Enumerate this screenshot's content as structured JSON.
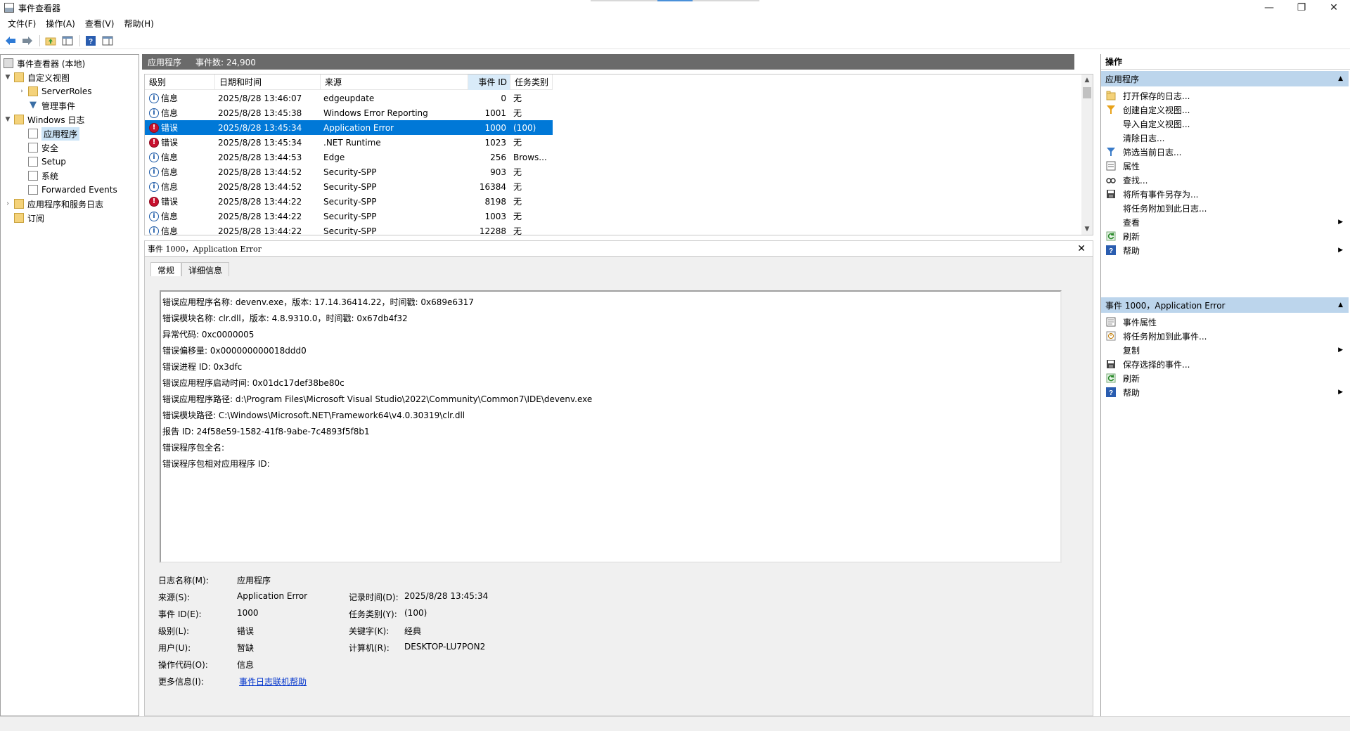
{
  "window": {
    "title": "事件查看器",
    "minimize": "—",
    "restore": "❐",
    "close": "✕"
  },
  "menu": [
    "文件(F)",
    "操作(A)",
    "查看(V)",
    "帮助(H)"
  ],
  "tree": {
    "root": "事件查看器 (本地)",
    "custom_views": "自定义视图",
    "server_roles": "ServerRoles",
    "admin_events": "管理事件",
    "windows_logs": "Windows 日志",
    "application": "应用程序",
    "security": "安全",
    "setup": "Setup",
    "system": "系统",
    "forwarded": "Forwarded Events",
    "app_service_logs": "应用程序和服务日志",
    "subscriptions": "订阅"
  },
  "center": {
    "log_name": "应用程序",
    "event_count": "事件数: 24,900"
  },
  "columns": [
    "级别",
    "日期和时间",
    "来源",
    "事件 ID",
    "任务类别"
  ],
  "events": [
    {
      "level": "信息",
      "type": "info",
      "datetime": "2025/8/28 13:46:07",
      "source": "edgeupdate",
      "id": "0",
      "category": "无"
    },
    {
      "level": "信息",
      "type": "info",
      "datetime": "2025/8/28 13:45:38",
      "source": "Windows Error Reporting",
      "id": "1001",
      "category": "无"
    },
    {
      "level": "错误",
      "type": "error",
      "datetime": "2025/8/28 13:45:34",
      "source": "Application Error",
      "id": "1000",
      "category": "(100)"
    },
    {
      "level": "错误",
      "type": "error",
      "datetime": "2025/8/28 13:45:34",
      "source": ".NET Runtime",
      "id": "1023",
      "category": "无"
    },
    {
      "level": "信息",
      "type": "info",
      "datetime": "2025/8/28 13:44:53",
      "source": "Edge",
      "id": "256",
      "category": "Brows..."
    },
    {
      "level": "信息",
      "type": "info",
      "datetime": "2025/8/28 13:44:52",
      "source": "Security-SPP",
      "id": "903",
      "category": "无"
    },
    {
      "level": "信息",
      "type": "info",
      "datetime": "2025/8/28 13:44:52",
      "source": "Security-SPP",
      "id": "16384",
      "category": "无"
    },
    {
      "level": "错误",
      "type": "error",
      "datetime": "2025/8/28 13:44:22",
      "source": "Security-SPP",
      "id": "8198",
      "category": "无"
    },
    {
      "level": "信息",
      "type": "info",
      "datetime": "2025/8/28 13:44:22",
      "source": "Security-SPP",
      "id": "1003",
      "category": "无"
    },
    {
      "level": "信息",
      "type": "info",
      "datetime": "2025/8/28 13:44:22",
      "source": "Security-SPP",
      "id": "12288",
      "category": "无"
    }
  ],
  "detail": {
    "header": "事件 1000，Application Error",
    "tab_general": "常规",
    "tab_details": "详细信息",
    "lines": [
      "错误应用程序名称: devenv.exe，版本: 17.14.36414.22，时间戳: 0x689e6317",
      "错误模块名称: clr.dll，版本: 4.8.9310.0，时间戳: 0x67db4f32",
      "异常代码: 0xc0000005",
      "错误偏移量: 0x000000000018ddd0",
      "错误进程 ID: 0x3dfc",
      "错误应用程序启动时间: 0x01dc17def38be80c",
      "错误应用程序路径: d:\\Program Files\\Microsoft Visual Studio\\2022\\Community\\Common7\\IDE\\devenv.exe",
      "错误模块路径: C:\\Windows\\Microsoft.NET\\Framework64\\v4.0.30319\\clr.dll",
      "报告 ID: 24f58e59-1582-41f8-9abe-7c4893f5f8b1",
      "错误程序包全名:",
      "错误程序包相对应用程序 ID:"
    ],
    "props": {
      "log_name_label": "日志名称(M):",
      "log_name": "应用程序",
      "source_label": "来源(S):",
      "source": "Application Error",
      "logged_label": "记录时间(D):",
      "logged": "2025/8/28 13:45:34",
      "event_id_label": "事件 ID(E):",
      "event_id": "1000",
      "task_label": "任务类别(Y):",
      "task": "(100)",
      "level_label": "级别(L):",
      "level": "错误",
      "keywords_label": "关键字(K):",
      "keywords": "经典",
      "user_label": "用户(U):",
      "user": "暂缺",
      "computer_label": "计算机(R):",
      "computer": "DESKTOP-LU7PON2",
      "opcode_label": "操作代码(O):",
      "opcode": "信息",
      "more_info_label": "更多信息(I):",
      "more_info": "事件日志联机帮助"
    }
  },
  "actions": {
    "title": "操作",
    "section1": "应用程序",
    "items1": [
      {
        "label": "打开保存的日志...",
        "icon": "open-log-icon"
      },
      {
        "label": "创建自定义视图...",
        "icon": "filter-create-icon"
      },
      {
        "label": "导入自定义视图...",
        "icon": ""
      },
      {
        "label": "清除日志...",
        "icon": ""
      },
      {
        "label": "筛选当前日志...",
        "icon": "filter-icon"
      },
      {
        "label": "属性",
        "icon": "properties-icon"
      },
      {
        "label": "查找...",
        "icon": "find-icon"
      },
      {
        "label": "将所有事件另存为...",
        "icon": "save-icon"
      },
      {
        "label": "将任务附加到此日志...",
        "icon": ""
      },
      {
        "label": "查看",
        "icon": "",
        "submenu": true
      },
      {
        "label": "刷新",
        "icon": "refresh-icon"
      },
      {
        "label": "帮助",
        "icon": "help-icon",
        "submenu": true
      }
    ],
    "section2": "事件 1000，Application Error",
    "items2": [
      {
        "label": "事件属性",
        "icon": "event-properties-icon"
      },
      {
        "label": "将任务附加到此事件...",
        "icon": "task-icon"
      },
      {
        "label": "复制",
        "icon": "",
        "submenu": true
      },
      {
        "label": "保存选择的事件...",
        "icon": "save-icon"
      },
      {
        "label": "刷新",
        "icon": "refresh-icon"
      },
      {
        "label": "帮助",
        "icon": "help-icon",
        "submenu": true
      }
    ]
  },
  "colors": {
    "selection": "#0078d7",
    "section_header": "#bcd5ec",
    "center_header": "#6a6a6a",
    "error_icon": "#c8102e",
    "info_icon": "#1e5ba8"
  }
}
